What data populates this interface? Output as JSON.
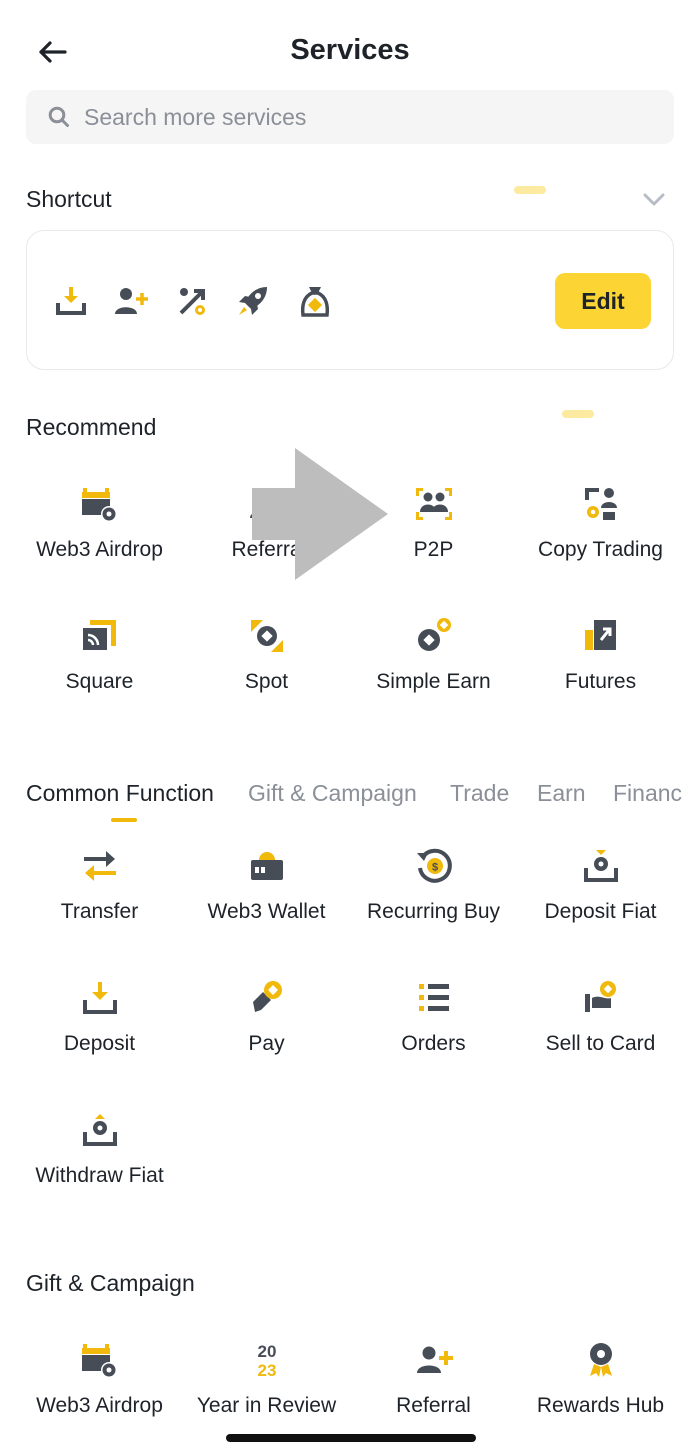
{
  "header": {
    "title": "Services"
  },
  "search": {
    "placeholder": "Search more services"
  },
  "shortcut": {
    "title": "Shortcut",
    "icons": [
      "deposit-icon",
      "add-user-icon",
      "percent-icon",
      "rocket-icon",
      "money-bag-icon"
    ],
    "edit_label": "Edit"
  },
  "recommend": {
    "title": "Recommend",
    "items": [
      {
        "label": "Web3 Airdrop",
        "icon": "web3-airdrop-icon"
      },
      {
        "label": "Referra",
        "icon": "referral-icon"
      },
      {
        "label": "P2P",
        "icon": "p2p-icon"
      },
      {
        "label": "Copy Trading",
        "icon": "copy-trading-icon"
      },
      {
        "label": "Square",
        "icon": "square-icon"
      },
      {
        "label": "Spot",
        "icon": "spot-icon"
      },
      {
        "label": "Simple Earn",
        "icon": "simple-earn-icon"
      },
      {
        "label": "Futures",
        "icon": "futures-icon"
      }
    ]
  },
  "tabs": [
    {
      "label": "Common Function",
      "active": true
    },
    {
      "label": "Gift & Campaign",
      "active": false
    },
    {
      "label": "Trade",
      "active": false
    },
    {
      "label": "Earn",
      "active": false
    },
    {
      "label": "Financ",
      "active": false
    }
  ],
  "common_function": {
    "items": [
      {
        "label": "Transfer",
        "icon": "transfer-icon"
      },
      {
        "label": "Web3 Wallet",
        "icon": "web3-wallet-icon"
      },
      {
        "label": "Recurring Buy",
        "icon": "recurring-buy-icon"
      },
      {
        "label": "Deposit Fiat",
        "icon": "deposit-fiat-icon"
      },
      {
        "label": "Deposit",
        "icon": "deposit-icon"
      },
      {
        "label": "Pay",
        "icon": "pay-icon"
      },
      {
        "label": "Orders",
        "icon": "orders-icon"
      },
      {
        "label": "Sell to Card",
        "icon": "sell-to-card-icon"
      },
      {
        "label": "Withdraw Fiat",
        "icon": "withdraw-fiat-icon"
      }
    ]
  },
  "gift_campaign": {
    "title": "Gift & Campaign",
    "year_top": "20",
    "year_bottom": "23",
    "items": [
      {
        "label": "Web3 Airdrop",
        "icon": "web3-airdrop-icon"
      },
      {
        "label": "Year in Review",
        "icon": "year-in-review-icon"
      },
      {
        "label": "Referral",
        "icon": "referral-icon"
      },
      {
        "label": "Rewards Hub",
        "icon": "rewards-hub-icon"
      }
    ]
  },
  "colors": {
    "accent": "#F0B90B",
    "button": "#FCD535",
    "icon_dark": "#474D57",
    "text": "#1E2329",
    "muted": "#8A8F98",
    "overlay_arrow": "#BDBDBD"
  }
}
